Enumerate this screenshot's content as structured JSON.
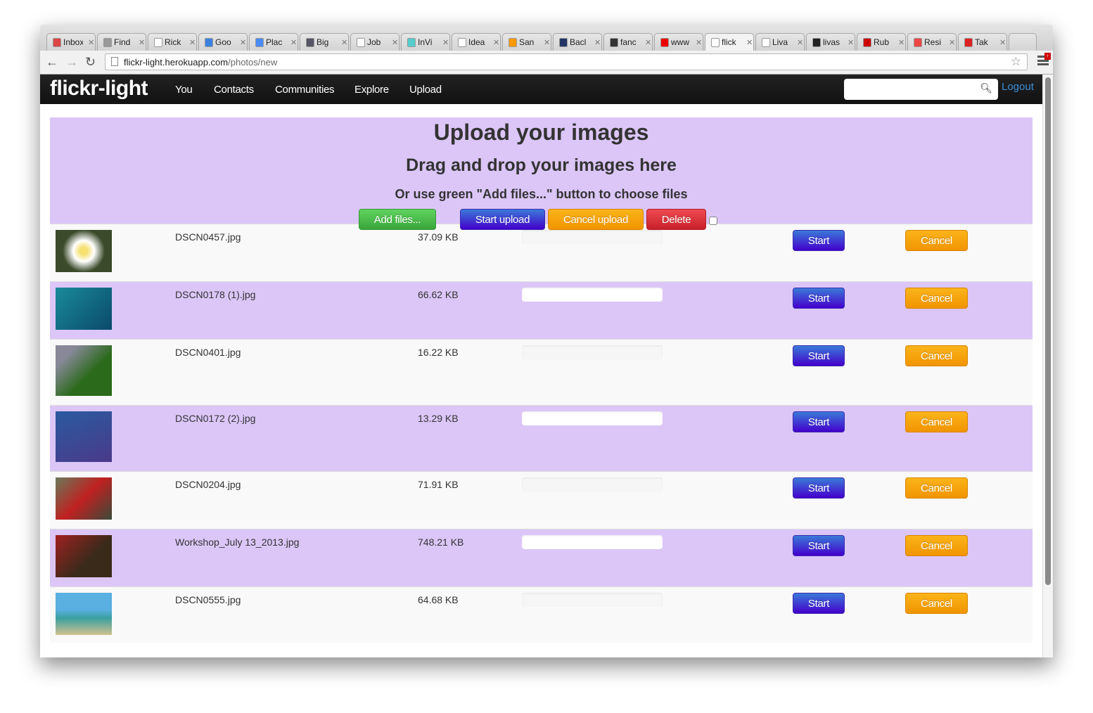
{
  "browser": {
    "tabs": [
      {
        "label": "Inbox",
        "icon": "gmail-icon",
        "color": "#d44"
      },
      {
        "label": "Find",
        "icon": "peace-icon",
        "color": "#999"
      },
      {
        "label": "Rick",
        "icon": "page-icon",
        "color": "#fff"
      },
      {
        "label": "Goo",
        "icon": "calendar-icon",
        "color": "#3b82e0"
      },
      {
        "label": "Plac",
        "icon": "docs-icon",
        "color": "#4a8af4"
      },
      {
        "label": "Big",
        "icon": "js-icon",
        "color": "#556"
      },
      {
        "label": "Job",
        "icon": "page-icon",
        "color": "#fff"
      },
      {
        "label": "InVi",
        "icon": "invision-icon",
        "color": "#5cc"
      },
      {
        "label": "Idea",
        "icon": "page-icon",
        "color": "#fff"
      },
      {
        "label": "San",
        "icon": "microsoft-icon",
        "color": "#f90"
      },
      {
        "label": "Bacl",
        "icon": "backbone-icon",
        "color": "#236"
      },
      {
        "label": "fanc",
        "icon": "bolt-icon",
        "color": "#333"
      },
      {
        "label": "www",
        "icon": "adobe-icon",
        "color": "#e00"
      },
      {
        "label": "flick",
        "icon": "page-icon",
        "color": "#fff",
        "active": true
      },
      {
        "label": "Liva",
        "icon": "page-icon",
        "color": "#fff"
      },
      {
        "label": "livas",
        "icon": "github-icon",
        "color": "#222"
      },
      {
        "label": "Rub",
        "icon": "ruby-icon",
        "color": "#c00"
      },
      {
        "label": "Resi",
        "icon": "pdf-icon",
        "color": "#e44"
      },
      {
        "label": "Tak",
        "icon": "apple-icon",
        "color": "#d22"
      }
    ],
    "url_host": "flickr-light.herokuapp.com",
    "url_path": "/photos/new"
  },
  "nav": {
    "brand": "flickr-light",
    "links": [
      "You",
      "Contacts",
      "Communities",
      "Explore",
      "Upload"
    ],
    "search_placeholder": "",
    "logout": "Logout"
  },
  "upload": {
    "title": "Upload your images",
    "subtitle": "Drag and drop your images here",
    "hint": "Or use green \"Add files...\" button to choose files",
    "add_files": "Add files...",
    "start_upload": "Start upload",
    "cancel_upload": "Cancel upload",
    "delete": "Delete"
  },
  "files": [
    {
      "name": "DSCN0457.jpg",
      "size": "37.09 KB",
      "progress": 0,
      "start": "Start",
      "cancel": "Cancel"
    },
    {
      "name": "DSCN0178 (1).jpg",
      "size": "66.62 KB",
      "progress": 0,
      "start": "Start",
      "cancel": "Cancel"
    },
    {
      "name": "DSCN0401.jpg",
      "size": "16.22 KB",
      "progress": 0,
      "start": "Start",
      "cancel": "Cancel"
    },
    {
      "name": "DSCN0172 (2).jpg",
      "size": "13.29 KB",
      "progress": 0,
      "start": "Start",
      "cancel": "Cancel"
    },
    {
      "name": "DSCN0204.jpg",
      "size": "71.91 KB",
      "progress": 0,
      "start": "Start",
      "cancel": "Cancel"
    },
    {
      "name": "Workshop_July 13_2013.jpg",
      "size": "748.21 KB",
      "progress": 0,
      "start": "Start",
      "cancel": "Cancel"
    },
    {
      "name": "DSCN0555.jpg",
      "size": "64.68 KB",
      "progress": 0,
      "start": "Start",
      "cancel": "Cancel"
    }
  ]
}
